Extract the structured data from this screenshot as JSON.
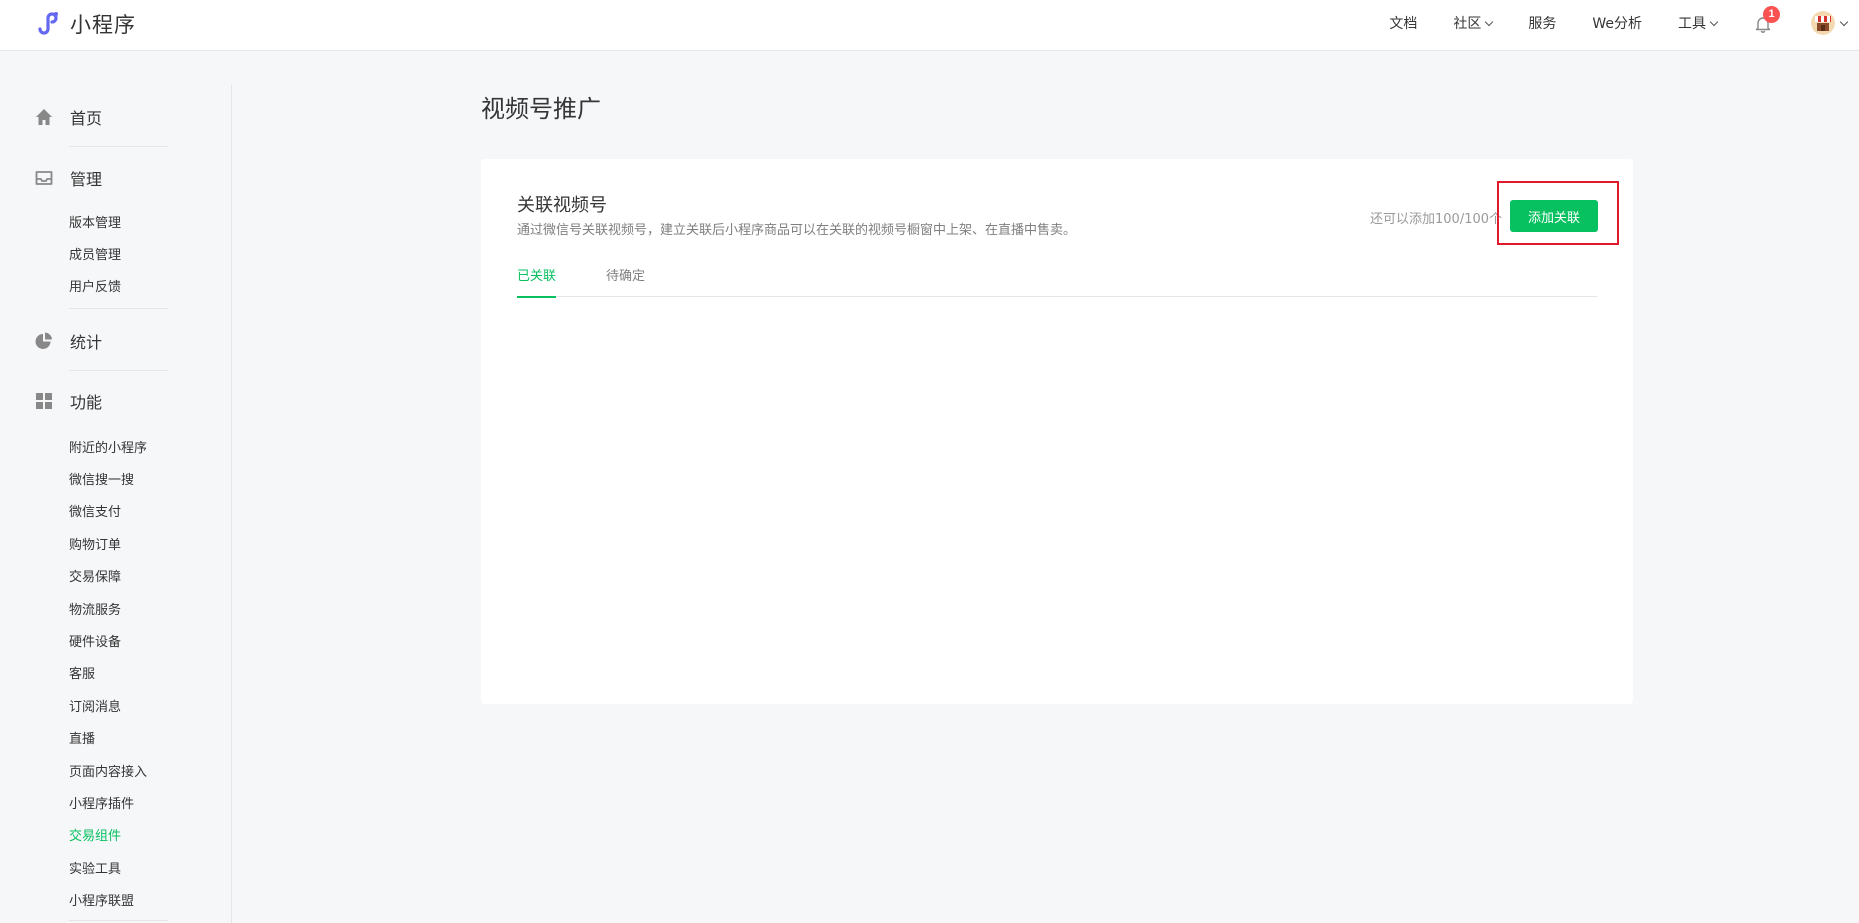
{
  "app": {
    "logo_text": "小程序"
  },
  "topnav": {
    "docs": "文档",
    "community": "社区",
    "service": "服务",
    "we_analytics": "We分析",
    "tools": "工具",
    "notification_count": "1"
  },
  "sidebar": {
    "home": "首页",
    "manage": {
      "label": "管理",
      "items": [
        "版本管理",
        "成员管理",
        "用户反馈"
      ]
    },
    "stats": "统计",
    "features": {
      "label": "功能",
      "items": [
        "附近的小程序",
        "微信搜一搜",
        "微信支付",
        "购物订单",
        "交易保障",
        "物流服务",
        "硬件设备",
        "客服",
        "订阅消息",
        "直播",
        "页面内容接入",
        "小程序插件",
        "交易组件",
        "实验工具",
        "小程序联盟"
      ],
      "active_item": "交易组件"
    }
  },
  "main": {
    "page_title": "视频号推广",
    "card": {
      "title": "关联视频号",
      "description": "通过微信号关联视频号，建立关联后小程序商品可以在关联的视频号橱窗中上架、在直播中售卖。",
      "quota": "还可以添加100/100个",
      "add_button": "添加关联",
      "tabs": [
        {
          "label": "已关联",
          "active": true
        },
        {
          "label": "待确定",
          "active": false
        }
      ]
    }
  },
  "colors": {
    "brand_green": "#07c160",
    "highlight_red": "#e1192d",
    "badge_red": "#fa5151",
    "logo_purple": "#6467f0"
  }
}
